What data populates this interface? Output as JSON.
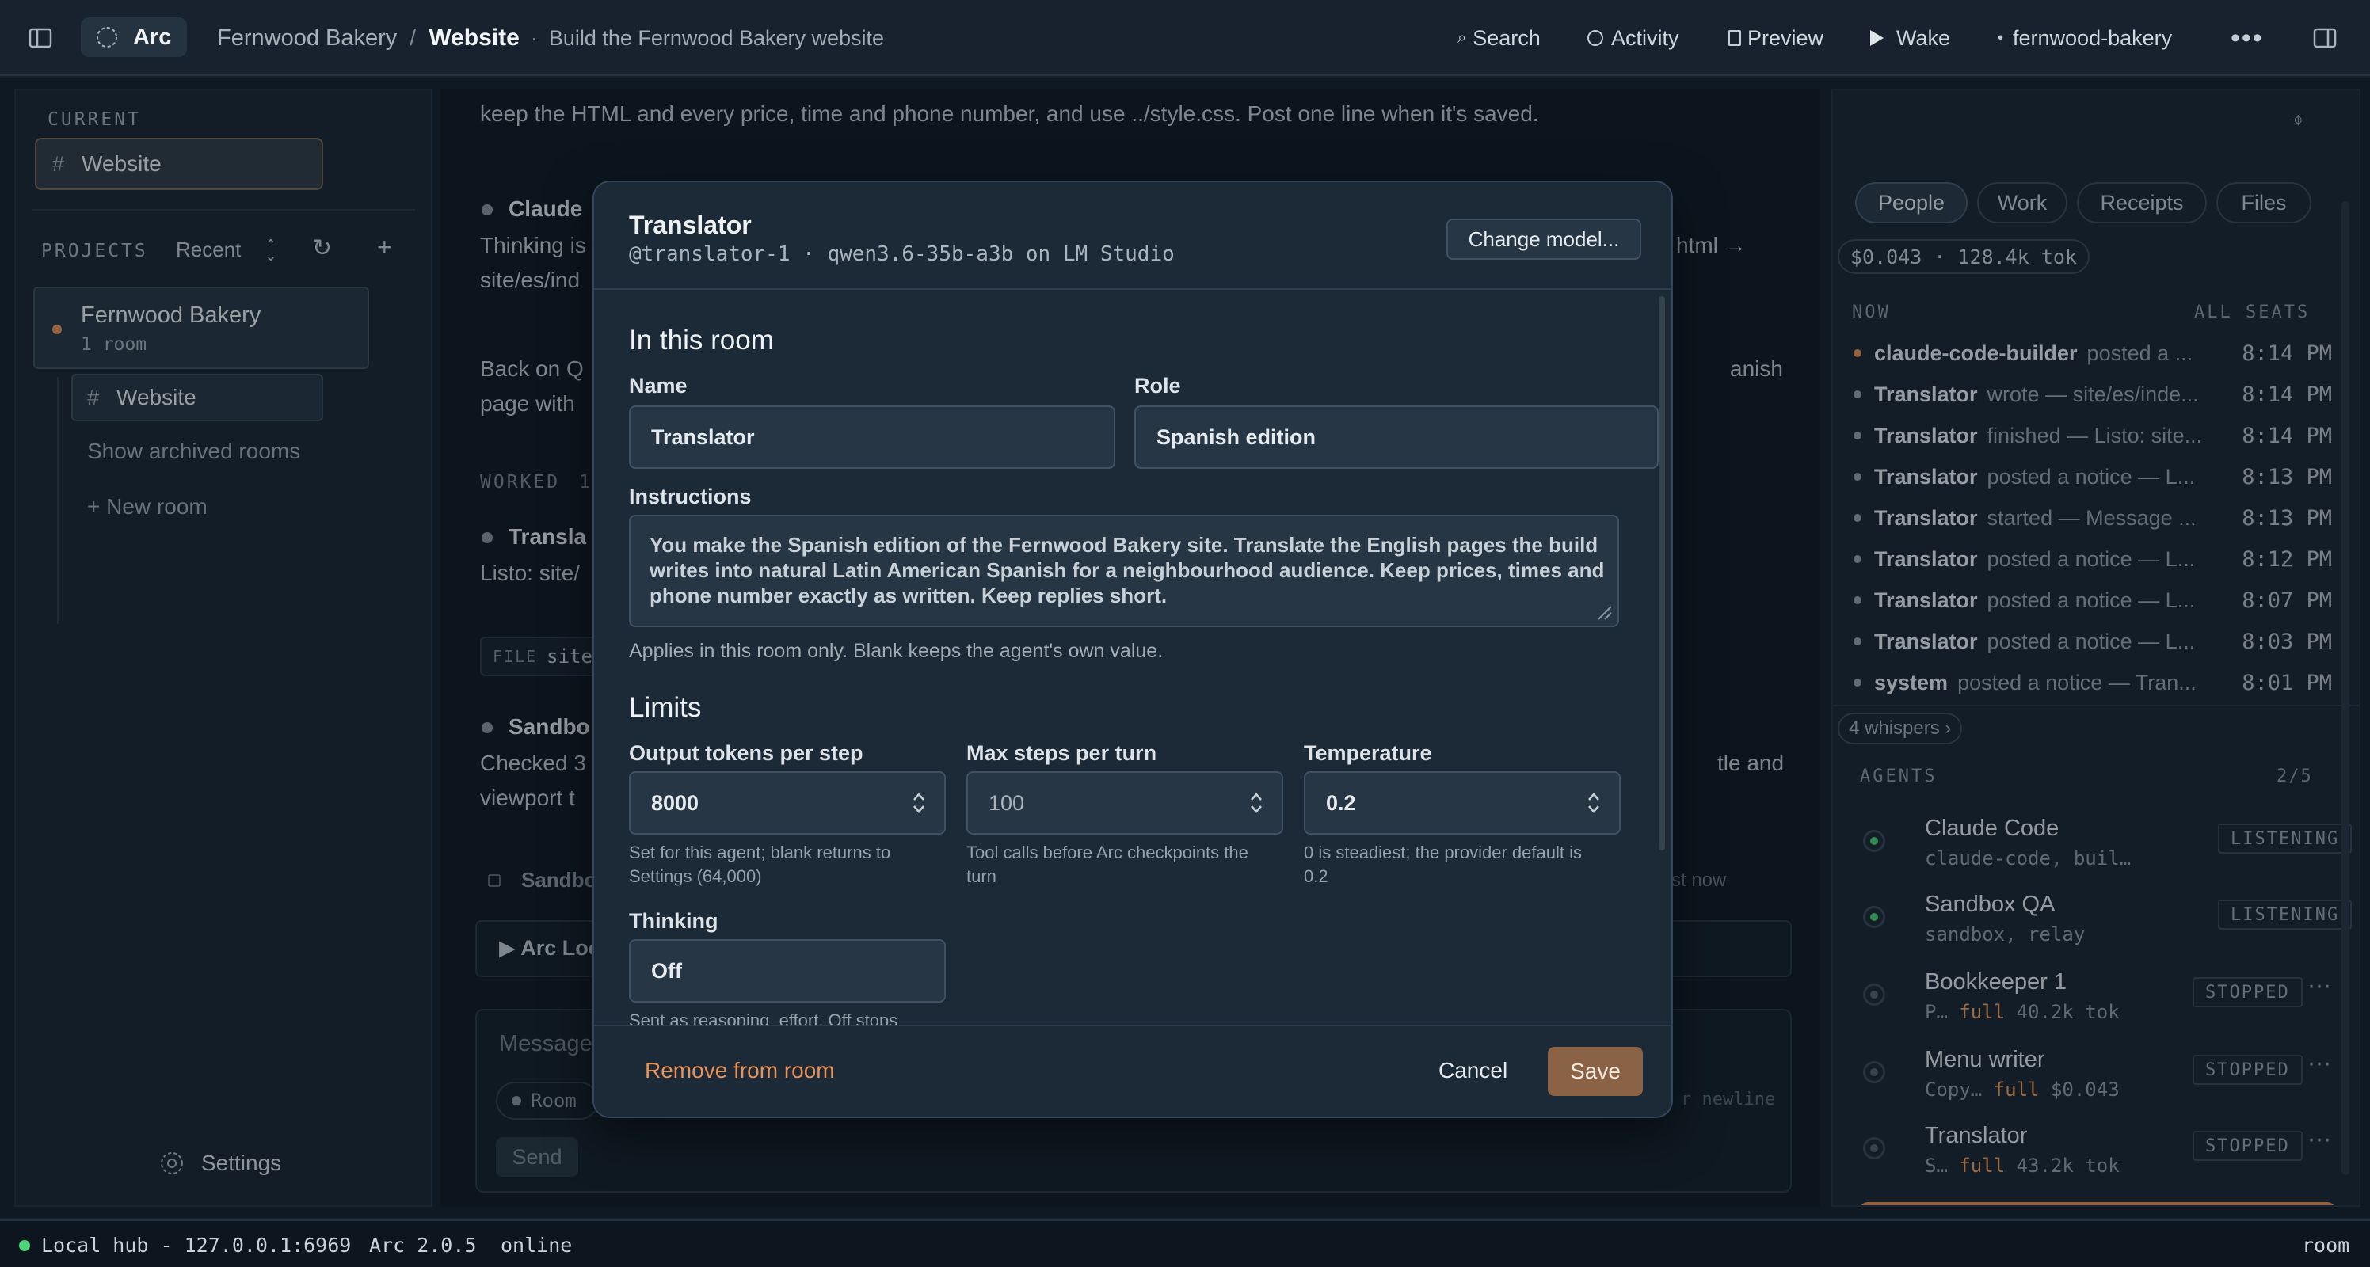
{
  "app": {
    "name": "Arc"
  },
  "topbar": {
    "project": "Fernwood Bakery",
    "separator": "/",
    "room": "Website",
    "room_dot": "·",
    "room_desc": "Build the Fernwood Bakery website",
    "search": "Search",
    "activity": "Activity",
    "preview": "Preview",
    "wake": "Wake",
    "workspace": "fernwood-bakery"
  },
  "sidebar": {
    "current_label": "CURRENT",
    "current_room": "Website",
    "projects_label": "PROJECTS",
    "sort": "Recent",
    "project": {
      "name": "Fernwood Bakery",
      "count": "1 room"
    },
    "room": "Website",
    "archived": "Show archived rooms",
    "new_room": "+ New room",
    "settings": "Settings"
  },
  "main": {
    "line1": "keep the HTML and every price, time and phone number, and use ../style.css. Post one line when it's saved.",
    "m1_name": "Claude",
    "m1_l1": "Thinking is",
    "m1_l1b": "html →",
    "m1_l2": "site/es/ind",
    "p2_l1": "Back on Q",
    "p2_l1b": "anish",
    "p2_l2": "page with",
    "worked": "WORKED",
    "worked_n": "1",
    "m2_name": "Transla",
    "m2_l1": "Listo: site/",
    "file_tag": "FILE",
    "file_name": "site",
    "m3_name": "Sandbo",
    "m3_l1": "Checked 3",
    "m3_l1b": "tle and",
    "m3_l2": "viewport t",
    "m4_name": "Sandbo",
    "m4_time": "st now",
    "arc_loc": "▶ Arc Loc",
    "composer_placeholder": "Message",
    "room_chip": "Room",
    "newline_hint": "r newline",
    "send": "Send"
  },
  "rpanel": {
    "tabs": [
      "People",
      "Work",
      "Receipts",
      "Files"
    ],
    "cost": "$0.043 · 128.4k tok",
    "now_label": "NOW",
    "all_seats": "ALL SEATS",
    "feed": [
      {
        "who": "claude-code-builder",
        "what": "posted a ...",
        "time": "8:14 PM",
        "accent": true
      },
      {
        "who": "Translator",
        "what": "wrote — site/es/inde...",
        "time": "8:14 PM"
      },
      {
        "who": "Translator",
        "what": "finished — Listo: site...",
        "time": "8:14 PM"
      },
      {
        "who": "Translator",
        "what": "posted a notice — L...",
        "time": "8:13 PM"
      },
      {
        "who": "Translator",
        "what": "started — Message ...",
        "time": "8:13 PM"
      },
      {
        "who": "Translator",
        "what": "posted a notice — L...",
        "time": "8:12 PM"
      },
      {
        "who": "Translator",
        "what": "posted a notice — L...",
        "time": "8:07 PM"
      },
      {
        "who": "Translator",
        "what": "posted a notice — L...",
        "time": "8:03 PM"
      },
      {
        "who": "system",
        "what": "posted a notice — Tran...",
        "time": "8:01 PM"
      }
    ],
    "whispers": "4 whispers ›",
    "agents_label": "AGENTS",
    "agents_count": "2/5",
    "agents": [
      {
        "name": "Claude Code",
        "sub": "claude-code, buil…",
        "badge": "LISTENING",
        "on": true
      },
      {
        "name": "Sandbox QA",
        "sub": "sandbox, relay",
        "badge": "LISTENING",
        "on": true
      },
      {
        "name": "Bookkeeper 1",
        "sub_a": "P…",
        "mode": "full",
        "sub_b": "40.2k tok",
        "badge": "STOPPED"
      },
      {
        "name": "Menu writer",
        "sub_a": "Copy…",
        "mode": "full",
        "sub_b": "$0.043",
        "badge": "STOPPED"
      },
      {
        "name": "Translator",
        "sub_a": "S…",
        "mode": "full",
        "sub_b": "43.2k tok",
        "badge": "STOPPED"
      }
    ]
  },
  "modal": {
    "title": "Translator",
    "subtitle": "@translator-1 · qwen3.6-35b-a3b on LM Studio",
    "change_model": "Change model...",
    "section_room": "In this room",
    "name_label": "Name",
    "name_value": "Translator",
    "role_label": "Role",
    "role_value": "Spanish edition",
    "instr_label": "Instructions",
    "instr_l1": "You make the Spanish edition of the Fernwood Bakery site. Translate the English pages the build",
    "instr_l2": "writes into natural Latin American Spanish for a neighbourhood audience. Keep prices, times and",
    "instr_l3": "phone number exactly as written. Keep replies short.",
    "instr_help": "Applies in this room only. Blank keeps the agent's own value.",
    "section_limits": "Limits",
    "tokens_label": "Output tokens per step",
    "tokens_value": "8000",
    "tokens_help1": "Set for this agent; blank returns to",
    "tokens_help2": "Settings (64,000)",
    "steps_label": "Max steps per turn",
    "steps_value": "100",
    "steps_help1": "Tool calls before Arc checkpoints the",
    "steps_help2": "turn",
    "temp_label": "Temperature",
    "temp_value": "0.2",
    "temp_help1": "0 is steadiest; the provider default is",
    "temp_help2": "0.2",
    "thinking_label": "Thinking",
    "thinking_value": "Off",
    "thinking_help": "Sent as reasoning_effort. Off stops",
    "remove": "Remove from room",
    "cancel": "Cancel",
    "save": "Save"
  },
  "statusbar": {
    "hub": "Local hub - 127.0.0.1:6969",
    "version": "Arc 2.0.5",
    "state": "online",
    "right": "room"
  },
  "colors": {
    "accent": "#e8935a",
    "save_bg": "#8a6245",
    "online": "#4fd37a"
  }
}
